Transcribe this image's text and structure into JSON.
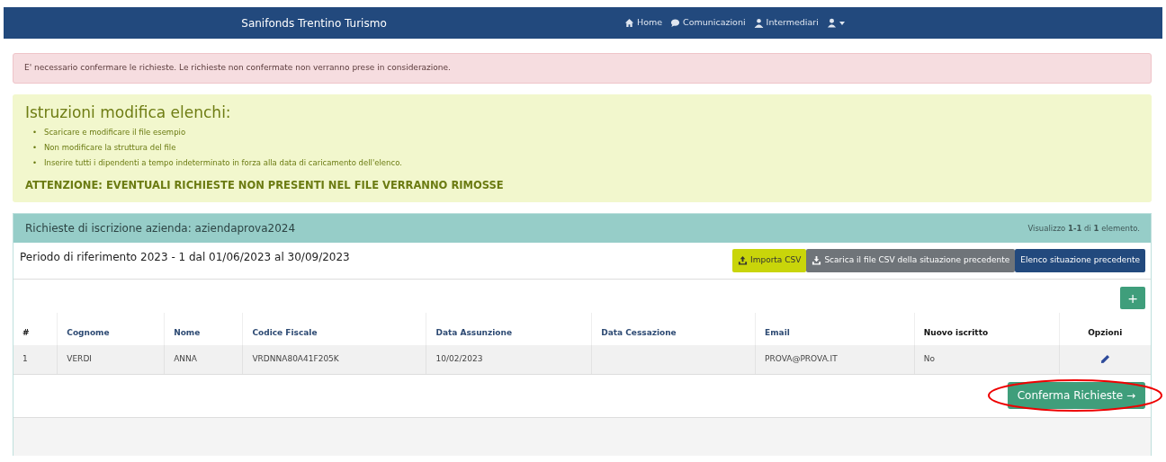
{
  "navbar": {
    "brand": "Sanifonds Trentino Turismo",
    "links": [
      {
        "kind": "home",
        "label": "Home",
        "dropdown": false
      },
      {
        "kind": "chat",
        "label": "Comunicazioni",
        "dropdown": false
      },
      {
        "kind": "people",
        "label": "Intermediari",
        "dropdown": false
      },
      {
        "kind": "account",
        "dropdown": true
      }
    ]
  },
  "alert": {
    "text": "E' necessario confermare le richieste. Le richieste non confermate non verranno prese in considerazione."
  },
  "instructions": {
    "title": "Istruzioni modifica elenchi:",
    "items": [
      {
        "marker": "•",
        "text": "Scaricare e modificare il file esempio"
      },
      {
        "marker": "•",
        "text": "Non modificare la struttura del file"
      },
      {
        "marker": "•",
        "text": "Inserire tutti i dipendenti a tempo indeterminato in forza alla data di caricamento dell'elenco."
      }
    ],
    "warning": "ATTENZIONE: EVENTUALI RICHIESTE NON PRESENTI NEL FILE VERRANNO RIMOSSE"
  },
  "panel": {
    "title": "Richieste di iscrizione azienda: aziendaprova2024",
    "summary": "Visualizzo **1-1** di **1** elemento.",
    "period": "Periodo di riferimento 2023 - 1 dal 01/06/2023 al 30/09/2023",
    "buttons": [
      {
        "kind": "upload",
        "label": "Importa CSV"
      },
      {
        "kind": "download",
        "label": "Scarica il file CSV della situazione precedente"
      },
      {
        "kind": "plain",
        "label": "Elenco situazione precedente"
      }
    ],
    "add_button": "+",
    "table": {
      "columns": [
        {
          "label": "#",
          "sortable": false
        },
        {
          "label": "Cognome",
          "sortable": true
        },
        {
          "label": "Nome",
          "sortable": true
        },
        {
          "label": "Codice Fiscale",
          "sortable": true
        },
        {
          "label": "Data Assunzione",
          "sortable": true
        },
        {
          "label": "Data Cessazione",
          "sortable": true
        },
        {
          "label": "Email",
          "sortable": true
        },
        {
          "label": "Nuovo iscritto",
          "sortable": false
        },
        {
          "label": "Opzioni",
          "sortable": false
        }
      ],
      "rows": [
        {
          "cells": [
            "1",
            "VERDI",
            "ANNA",
            "VRDNNA80A41F205K",
            "10/02/2023",
            "",
            "PROVA@PROVA.IT",
            "No"
          ],
          "editable": true
        }
      ]
    },
    "confirm_button": {
      "label": "Conferma Richieste",
      "icon": "→",
      "circled": true
    }
  }
}
